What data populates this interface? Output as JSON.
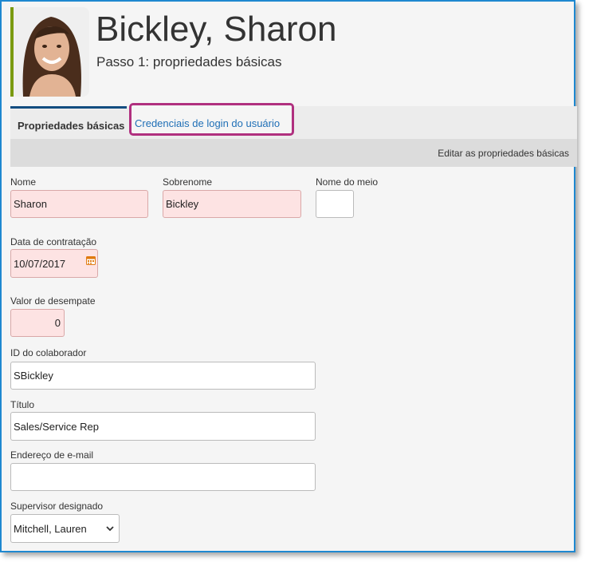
{
  "header": {
    "user_name": "Bickley, Sharon",
    "step_title": "Passo 1: propriedades básicas"
  },
  "tabs": [
    {
      "label": "Propriedades básicas",
      "active": true
    },
    {
      "label": "Credenciais de login do usuário",
      "active": false
    }
  ],
  "subbar": {
    "title": "Editar as propriedades básicas"
  },
  "form": {
    "first_name": {
      "label": "Nome",
      "value": "Sharon"
    },
    "last_name": {
      "label": "Sobrenome",
      "value": "Bickley"
    },
    "middle_name": {
      "label": "Nome do meio",
      "value": ""
    },
    "hire_date": {
      "label": "Data de contratação",
      "value": "10/07/2017"
    },
    "tiebreaker": {
      "label": "Valor de desempate",
      "value": "0"
    },
    "employee_id": {
      "label": "ID do colaborador",
      "value": "SBickley"
    },
    "title": {
      "label": "Título",
      "value": "Sales/Service Rep"
    },
    "email": {
      "label": "Endereço de e-mail",
      "value": ""
    },
    "supervisor": {
      "label": "Supervisor designado",
      "value": "Mitchell, Lauren"
    }
  },
  "colors": {
    "frame_border": "#1e88d0",
    "tab_highlight": "#b0307f",
    "link": "#1f6fb6",
    "required_field": "#fde3e3"
  }
}
